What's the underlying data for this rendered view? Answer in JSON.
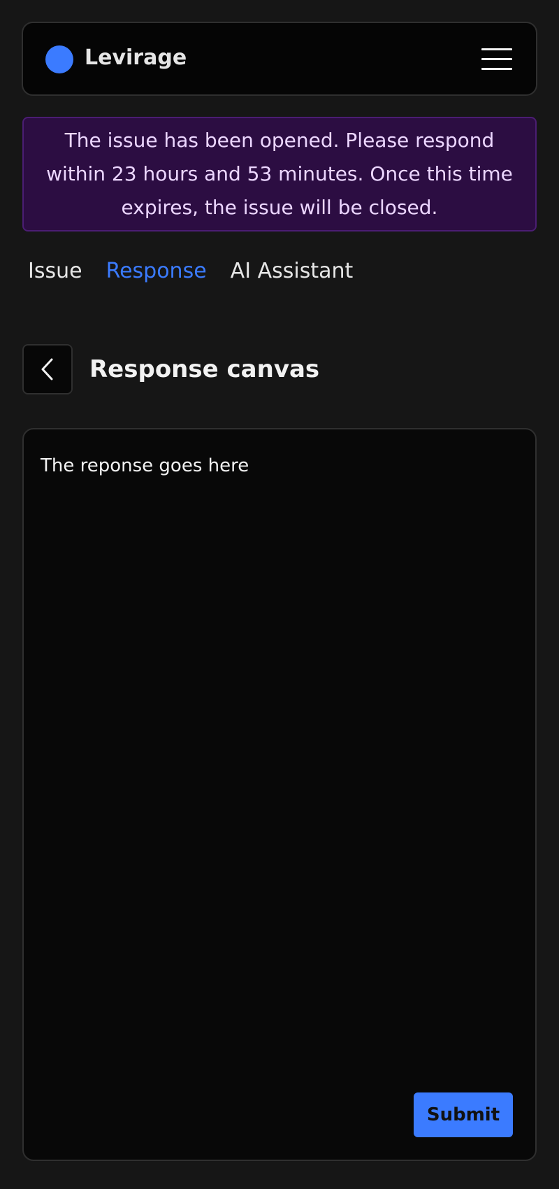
{
  "header": {
    "brand": "Levirage",
    "logo_icon": "circle-logo-icon",
    "menu_icon": "hamburger-menu-icon"
  },
  "notice": {
    "text": "The issue has been opened. Please respond within 23 hours and 53 minutes. Once this time expires, the issue will be closed."
  },
  "tabs": [
    {
      "label": "Issue",
      "active": false
    },
    {
      "label": "Response",
      "active": true
    },
    {
      "label": "AI Assistant",
      "active": false
    }
  ],
  "section": {
    "title": "Response canvas",
    "back_icon": "chevron-left-icon"
  },
  "canvas": {
    "text": "The reponse goes here",
    "submit_label": "Submit"
  },
  "colors": {
    "accent": "#3b7bff",
    "background": "#161616",
    "notice_bg": "#2c0d42",
    "notice_text": "#ecd6ff"
  }
}
